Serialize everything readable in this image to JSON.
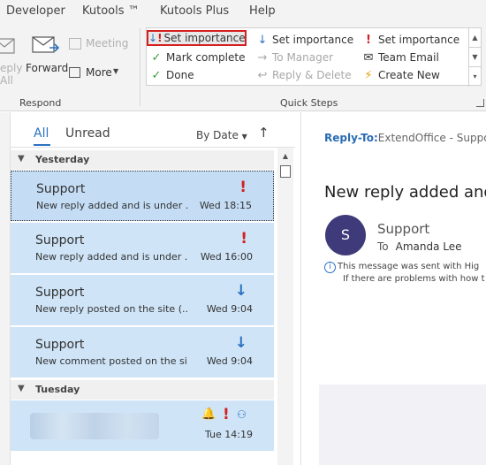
{
  "menu": [
    "Developer",
    "Kutools ™",
    "Kutools Plus",
    "Help"
  ],
  "ribbon": {
    "respond": {
      "reply_all": "eply\nAll",
      "forward": "Forward",
      "meeting": "Meeting",
      "more": "More",
      "group_label": "Respond"
    },
    "quick_steps": {
      "group_label": "Quick Steps",
      "items": [
        {
          "label": "Set importance",
          "icon": "arrow-down-exclaim-icon",
          "highlighted": true,
          "disabled": false
        },
        {
          "label": "Mark complete",
          "icon": "check-icon",
          "disabled": false
        },
        {
          "label": "Done",
          "icon": "check-icon",
          "disabled": false
        },
        {
          "label": "Set importance",
          "icon": "arrow-down-icon",
          "disabled": false
        },
        {
          "label": "To Manager",
          "icon": "forward-arrow-icon",
          "disabled": true
        },
        {
          "label": "Reply & Delete",
          "icon": "reply-icon",
          "disabled": true
        },
        {
          "label": "Set importance",
          "icon": "exclamation-icon",
          "disabled": false
        },
        {
          "label": "Team Email",
          "icon": "envelope-icon",
          "disabled": false
        },
        {
          "label": "Create New",
          "icon": "lightning-icon",
          "disabled": false
        }
      ]
    }
  },
  "list": {
    "filters": {
      "all": "All",
      "unread": "Unread"
    },
    "sort": "By Date",
    "groups": [
      {
        "label": "Yesterday",
        "mails": [
          {
            "sender": "Support",
            "subject": "New reply added and is under ...",
            "time": "Wed 18:15",
            "importance": "high",
            "selected": true
          },
          {
            "sender": "Support",
            "subject": "New reply added and is under ...",
            "time": "Wed 16:00",
            "importance": "high",
            "selected": false
          },
          {
            "sender": "Support",
            "subject": "New reply posted on the site (...",
            "time": "Wed 9:04",
            "importance": "low",
            "selected": false
          },
          {
            "sender": "Support",
            "subject": "New comment posted on the si...",
            "time": "Wed 9:04",
            "importance": "low",
            "selected": false
          }
        ]
      },
      {
        "label": "Tuesday",
        "mails": [
          {
            "sender": "",
            "subject": "",
            "time": "Tue 14:19",
            "importance": "high",
            "selected": false
          }
        ]
      }
    ]
  },
  "reading": {
    "reply_to_label": "Reply-To:",
    "reply_to_value": "ExtendOffice - Support",
    "title": "New reply added and",
    "avatar_initial": "S",
    "from": "Support",
    "to_label": "To",
    "to_value": "Amanda Lee",
    "info_line1": "This message was sent with Hig",
    "info_line2": "If there are problems with how t"
  },
  "colors": {
    "accent": "#2a72c2",
    "high": "#d42020",
    "selected_row": "#cfe4f7",
    "avatar": "#3f3b7a"
  }
}
